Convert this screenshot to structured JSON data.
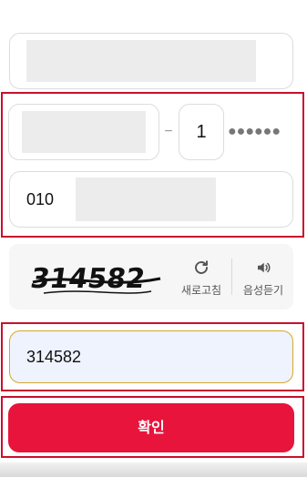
{
  "form": {
    "gender_digit": "1",
    "masked_digits": "●●●●●●",
    "dash": "−",
    "phone_prefix": "010",
    "captcha": {
      "text": "314582",
      "refresh_label": "새로고침",
      "audio_label": "음성듣기"
    },
    "captcha_input_value": "314582",
    "confirm_label": "확인"
  },
  "colors": {
    "accent": "#e8143c",
    "highlight": "#c8102e",
    "input_focus_border": "#d4a72c",
    "input_focus_bg": "#eef3fd"
  }
}
